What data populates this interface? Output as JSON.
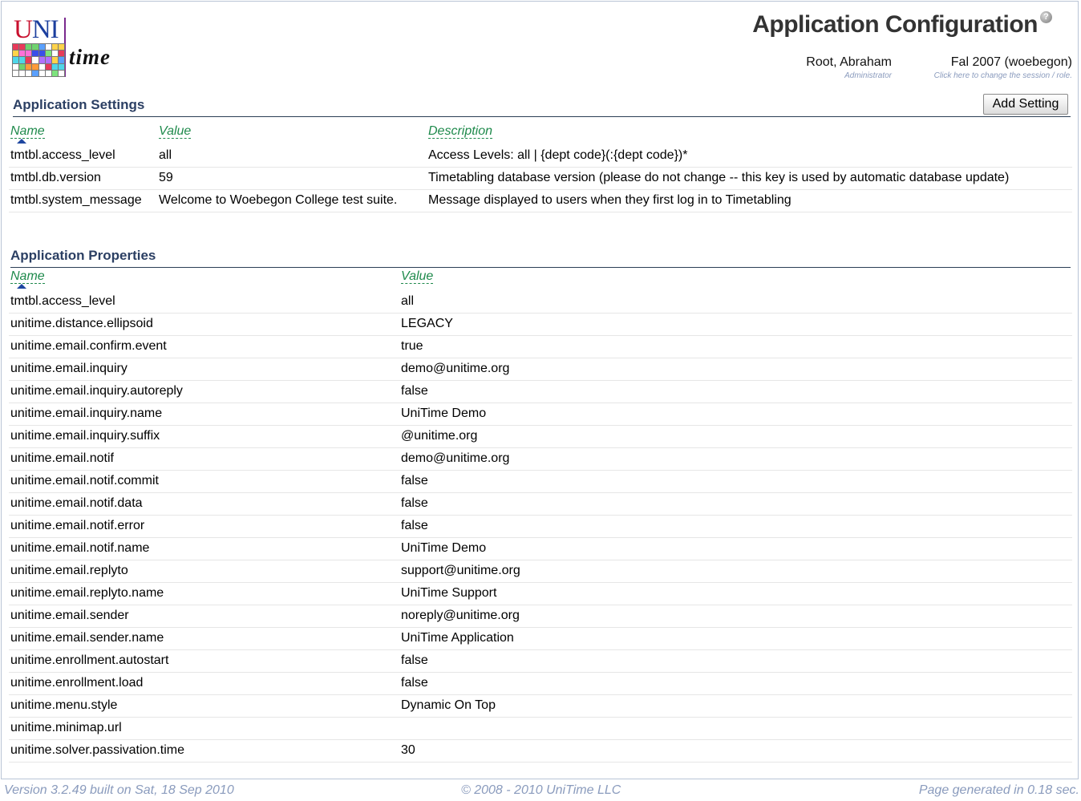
{
  "logo": {
    "uni_u": "U",
    "uni_ni": "NI",
    "time": "time"
  },
  "header": {
    "title": "Application Configuration",
    "help_icon": "help-icon",
    "user": {
      "name": "Root, Abraham",
      "role": "Administrator"
    },
    "session": {
      "name": "Fal 2007 (woebegon)",
      "hint": "Click here to change the session / role."
    }
  },
  "settings": {
    "title": "Application Settings",
    "add_button": "Add Setting",
    "columns": {
      "name": "Name",
      "value": "Value",
      "description": "Description"
    },
    "rows": [
      {
        "name": "tmtbl.access_level",
        "value": "all",
        "description": "Access Levels: all | {dept code}(:{dept code})*"
      },
      {
        "name": "tmtbl.db.version",
        "value": "59",
        "description": "Timetabling database version (please do not change -- this key is used by automatic database update)"
      },
      {
        "name": "tmtbl.system_message",
        "value": "Welcome to Woebegon College test suite.",
        "description": "Message displayed to users when they first log in to Timetabling"
      }
    ]
  },
  "properties": {
    "title": "Application Properties",
    "columns": {
      "name": "Name",
      "value": "Value"
    },
    "rows": [
      {
        "name": "tmtbl.access_level",
        "value": "all"
      },
      {
        "name": "unitime.distance.ellipsoid",
        "value": "LEGACY"
      },
      {
        "name": "unitime.email.confirm.event",
        "value": "true"
      },
      {
        "name": "unitime.email.inquiry",
        "value": "demo@unitime.org"
      },
      {
        "name": "unitime.email.inquiry.autoreply",
        "value": "false"
      },
      {
        "name": "unitime.email.inquiry.name",
        "value": "UniTime Demo"
      },
      {
        "name": "unitime.email.inquiry.suffix",
        "value": "@unitime.org"
      },
      {
        "name": "unitime.email.notif",
        "value": "demo@unitime.org"
      },
      {
        "name": "unitime.email.notif.commit",
        "value": "false"
      },
      {
        "name": "unitime.email.notif.data",
        "value": "false"
      },
      {
        "name": "unitime.email.notif.error",
        "value": "false"
      },
      {
        "name": "unitime.email.notif.name",
        "value": "UniTime Demo"
      },
      {
        "name": "unitime.email.replyto",
        "value": "support@unitime.org"
      },
      {
        "name": "unitime.email.replyto.name",
        "value": "UniTime Support"
      },
      {
        "name": "unitime.email.sender",
        "value": "noreply@unitime.org"
      },
      {
        "name": "unitime.email.sender.name",
        "value": "UniTime Application"
      },
      {
        "name": "unitime.enrollment.autostart",
        "value": "false"
      },
      {
        "name": "unitime.enrollment.load",
        "value": "false"
      },
      {
        "name": "unitime.menu.style",
        "value": "Dynamic On Top"
      },
      {
        "name": "unitime.minimap.url",
        "value": ""
      },
      {
        "name": "unitime.solver.passivation.time",
        "value": "30"
      }
    ]
  },
  "footer": {
    "version": "Version 3.2.49 built on Sat, 18 Sep 2010",
    "copyright": "© 2008 - 2010 UniTime LLC",
    "generated": "Page generated in 0.18 sec."
  },
  "colors": {
    "accent": "#2b3f63",
    "column_header": "#1f8a4c",
    "muted": "#8a9bbd",
    "sort_arrow": "#1e46a0"
  }
}
